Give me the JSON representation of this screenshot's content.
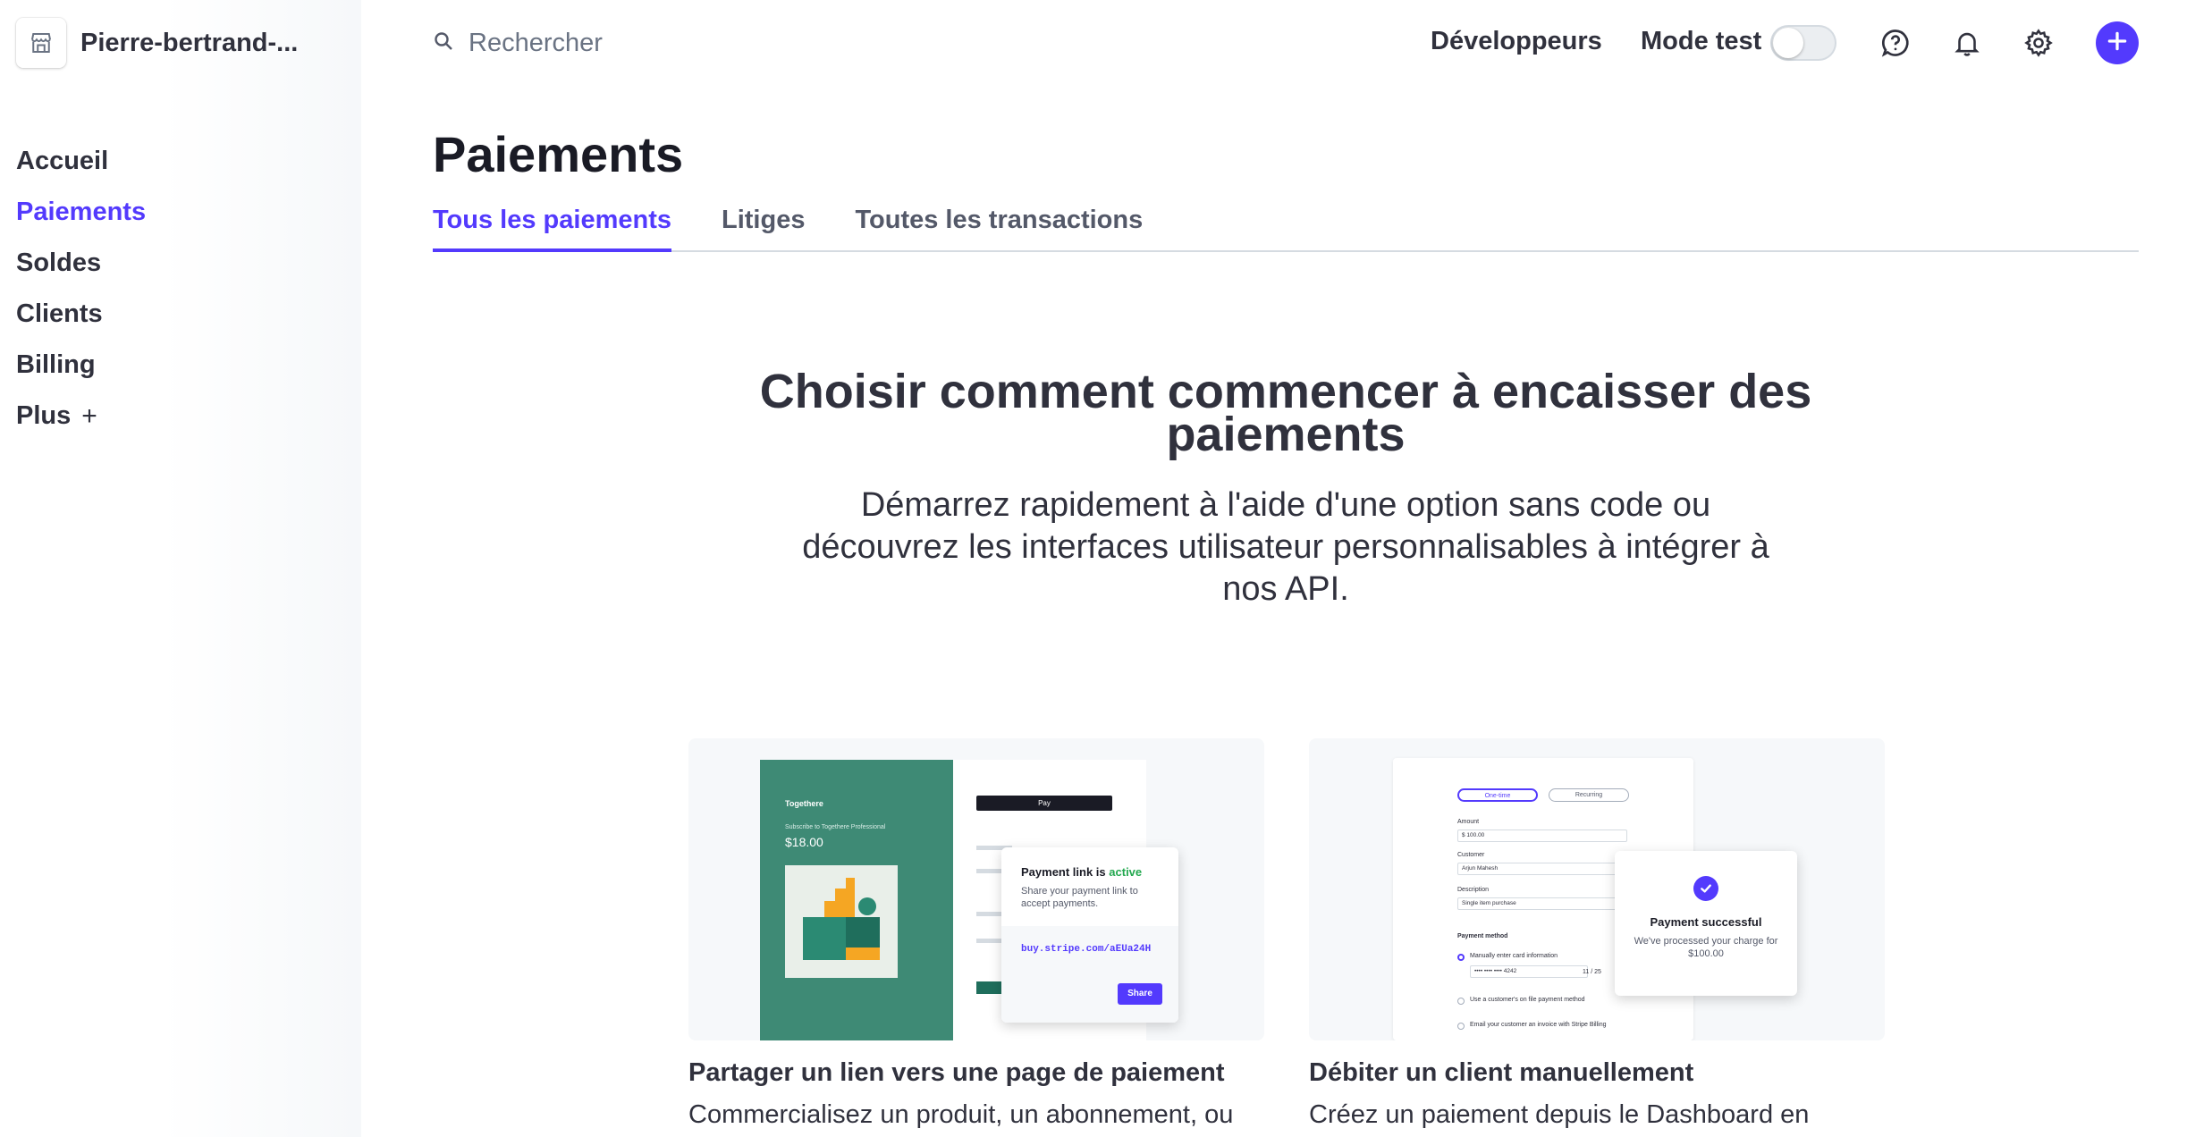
{
  "sidebar": {
    "account_name": "Pierre-bertrand-...",
    "items": [
      {
        "label": "Accueil"
      },
      {
        "label": "Paiements"
      },
      {
        "label": "Soldes"
      },
      {
        "label": "Clients"
      },
      {
        "label": "Billing"
      },
      {
        "label": "Plus",
        "suffix": "+"
      }
    ],
    "active_item": "Paiements"
  },
  "topbar": {
    "search_placeholder": "Rechercher",
    "developers_label": "Développeurs",
    "test_mode_label": "Mode test",
    "test_mode_on": false,
    "icons": [
      "help-icon",
      "bell-icon",
      "gear-icon",
      "plus-icon"
    ]
  },
  "main": {
    "title": "Paiements",
    "tabs": [
      {
        "label": "Tous les paiements"
      },
      {
        "label": "Litiges"
      },
      {
        "label": "Toutes les transactions"
      }
    ],
    "active_tab": "Tous les paiements",
    "hero_title": "Choisir comment commencer à encaisser des paiements",
    "hero_subtitle": "Démarrez rapidement à l'aide d'une option sans code ou découvrez les interfaces utilisateur personnalisables à intégrer à nos API.",
    "cards": [
      {
        "title": "Partager un lien vers une page de paiement",
        "description": "Commercialisez un produit, un abonnement, ou",
        "illustration": {
          "brand": "Togethere",
          "subscribe_text": "Subscribe to Togethere Professional",
          "price": "$18.00",
          "apple_pay": "Pay",
          "popup_title": "Payment link is",
          "popup_status": "active",
          "popup_text": "Share your payment link to accept payments.",
          "url": "buy.stripe.com/aEUa24H",
          "share_label": "Share"
        }
      },
      {
        "title": "Débiter un client manuellement",
        "description": "Créez un paiement depuis le Dashboard en",
        "illustration": {
          "one_time": "One-time",
          "recurring": "Recurring",
          "amount_label": "Amount",
          "amount_value": "$ 100.00",
          "customer_label": "Customer",
          "customer_value": "Arjun Mahesh",
          "description_label": "Description",
          "description_value": "Single item purchase",
          "payment_method_label": "Payment method",
          "manual_card": "Manually enter card information",
          "card_number": "•••• •••• •••• 4242",
          "card_expiry": "11 / 25",
          "on_file": "Use a customer's on file payment method",
          "invoice": "Email your customer an invoice with Stripe Billing",
          "popup_title": "Payment successful",
          "popup_text": "We've processed your charge for $100.00"
        }
      }
    ]
  },
  "colors": {
    "accent": "#533afd",
    "text": "#30313d",
    "muted": "#545969",
    "green_panel": "#3e8a75",
    "active_green": "#23a84f"
  }
}
